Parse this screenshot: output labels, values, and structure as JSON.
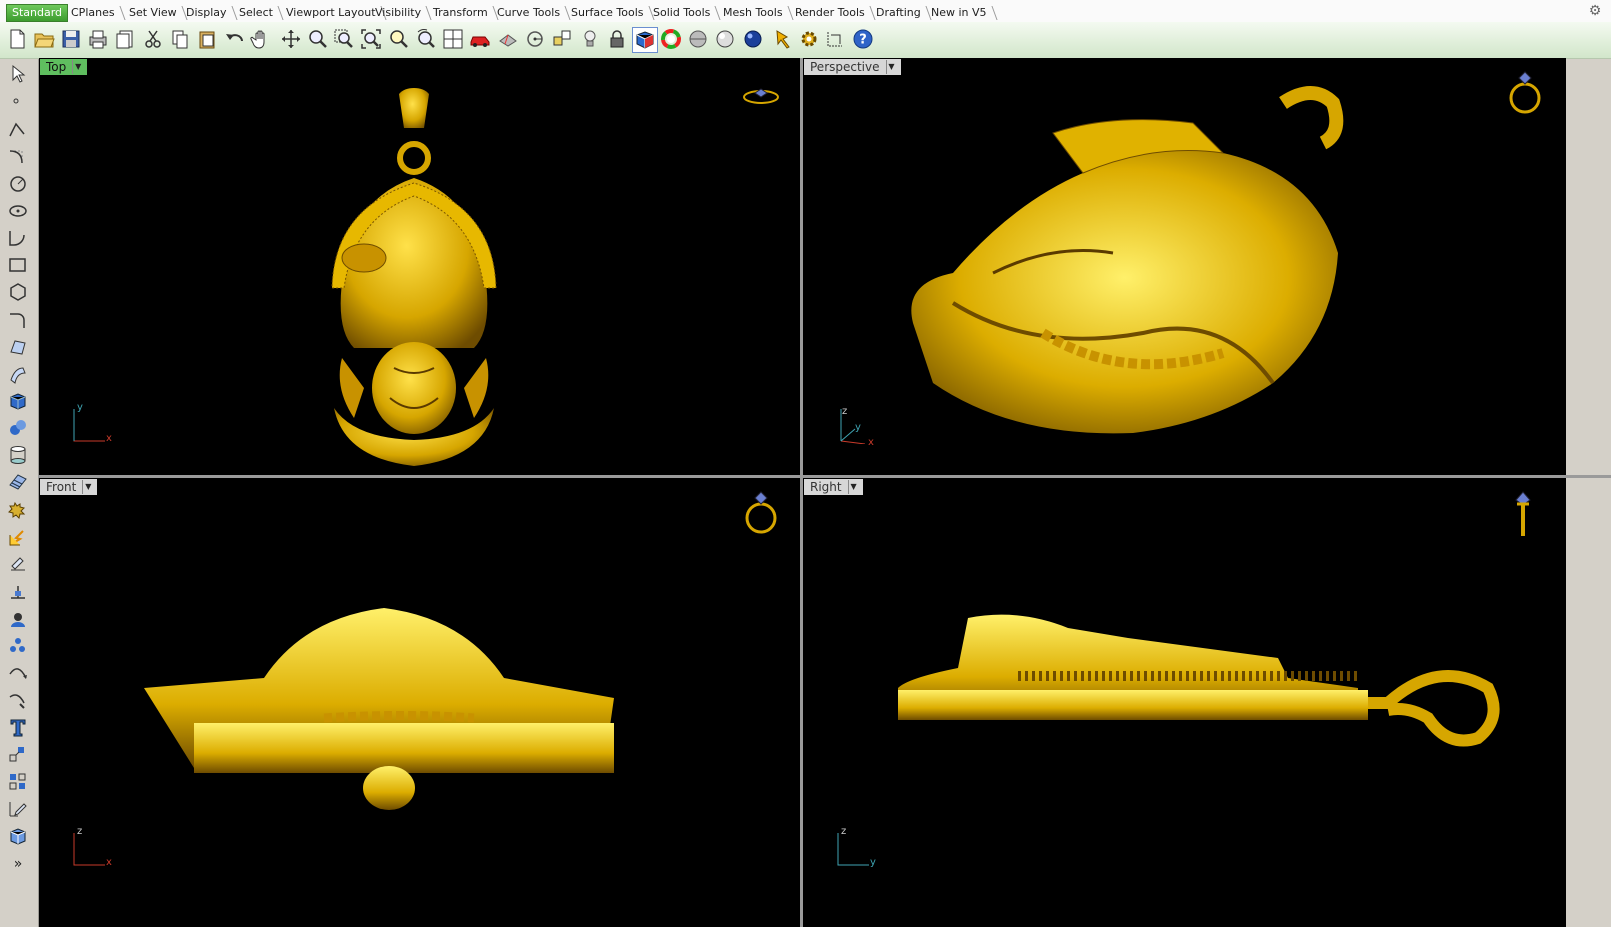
{
  "tabs": [
    {
      "label": "Standard",
      "active": true
    },
    {
      "label": "CPlanes"
    },
    {
      "label": "Set View"
    },
    {
      "label": "Display"
    },
    {
      "label": "Select"
    },
    {
      "label": "Viewport Layout"
    },
    {
      "label": "Visibility"
    },
    {
      "label": "Transform"
    },
    {
      "label": "Curve Tools"
    },
    {
      "label": "Surface Tools"
    },
    {
      "label": "Solid Tools"
    },
    {
      "label": "Mesh Tools"
    },
    {
      "label": "Render Tools"
    },
    {
      "label": "Drafting"
    },
    {
      "label": "New in V5"
    }
  ],
  "toolbar_icons": [
    "new",
    "open",
    "save",
    "print",
    "import",
    "cut",
    "copy",
    "paste",
    "undo",
    "pan-hand",
    "move-view",
    "zoom-dynamic",
    "zoom-window",
    "zoom-extents",
    "zoom-selected",
    "rotate-view",
    "four-viewports",
    "car-properties",
    "hide",
    "circle-point",
    "snap",
    "light-bulb",
    "lock",
    "shaded-viewport",
    "color-wheel",
    "render-preview",
    "material-sphere",
    "blue-sphere",
    "pointer-pin",
    "gear-options",
    "dimension",
    "help"
  ],
  "left_icons": [
    "select-arrow",
    "point",
    "polyline",
    "curve-cv",
    "circle",
    "ellipse",
    "arc",
    "rectangle",
    "polygon",
    "fillet-curve",
    "surface-patch",
    "extrude-surface",
    "solid-box",
    "boolean-solids",
    "cylinder-mesh",
    "mesh-plane",
    "explode",
    "transform-move",
    "analyze-tool",
    "offset",
    "boolean-union",
    "group",
    "curve-from-objects",
    "curve-tools",
    "text",
    "transform-array",
    "array",
    "dimensions",
    "view-cube",
    "more-tools"
  ],
  "viewports": {
    "top": {
      "label": "Top",
      "axis": [
        "y",
        "x"
      ]
    },
    "perspective": {
      "label": "Perspective",
      "axis": [
        "z",
        "y",
        "x"
      ]
    },
    "front": {
      "label": "Front",
      "axis": [
        "z",
        "x"
      ]
    },
    "right": {
      "label": "Right",
      "axis": [
        "z",
        "y"
      ]
    }
  },
  "colors": {
    "gold": "#d6a600",
    "axis_x": "#c83a2a",
    "axis_y": "#3fa5b3",
    "viewport_bg": "#000000"
  }
}
